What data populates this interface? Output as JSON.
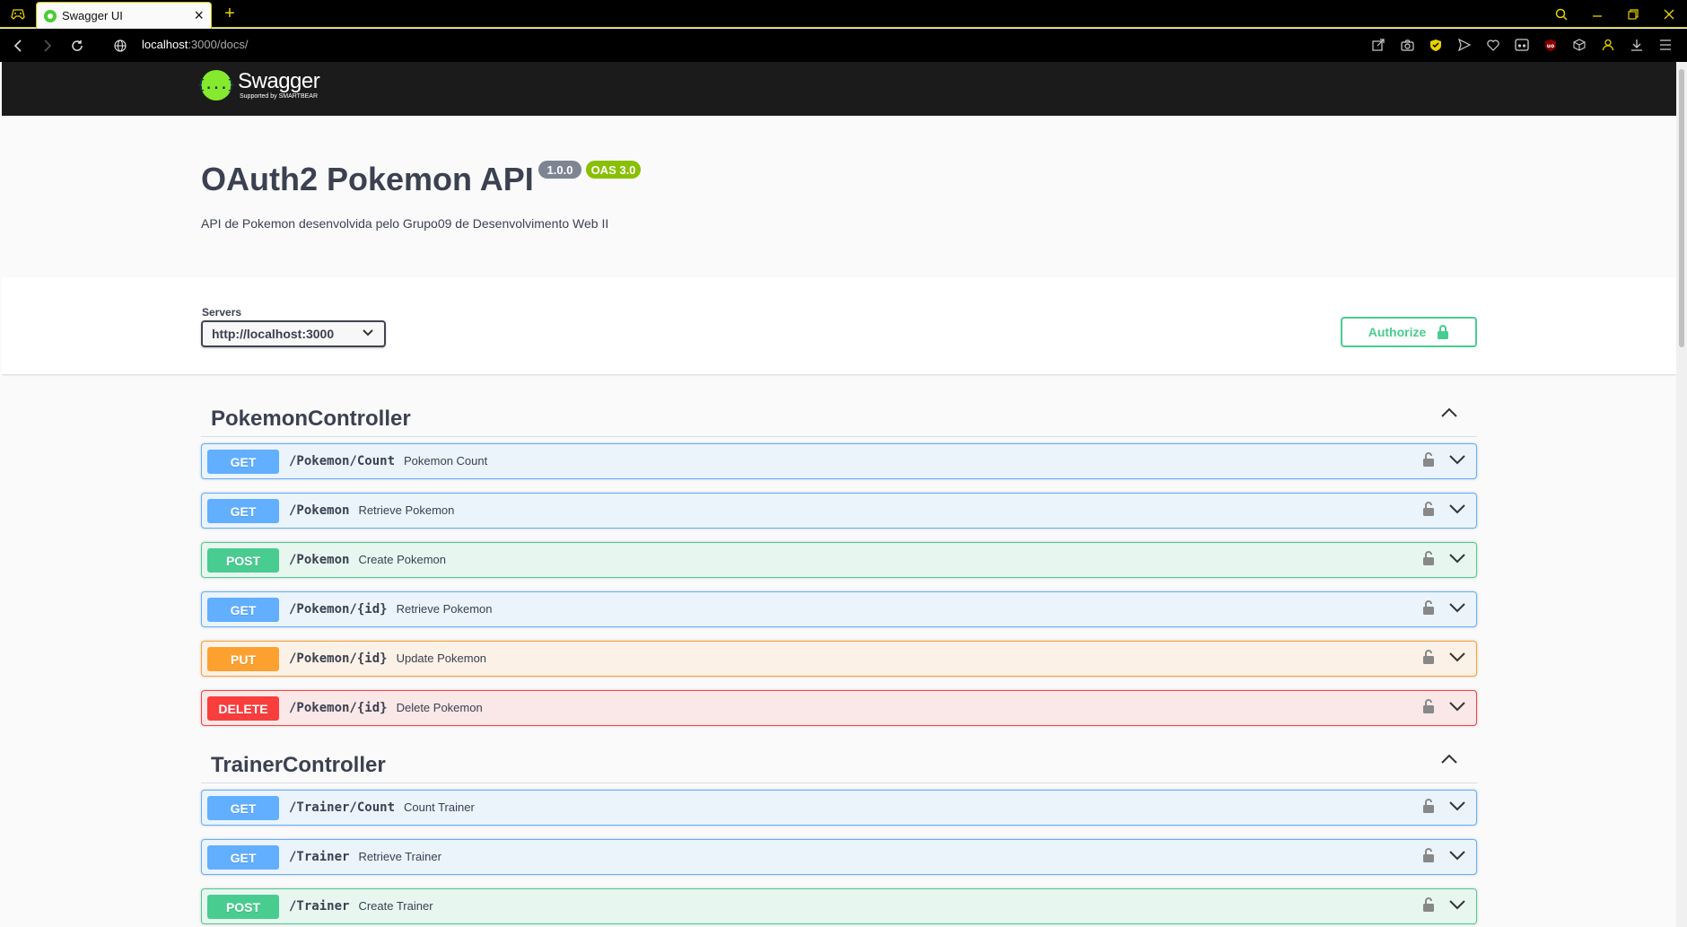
{
  "browser": {
    "tab_title": "Swagger UI",
    "url_host": "localhost",
    "url_rest": ":3000/docs/"
  },
  "swagger": {
    "logo_name": "Swagger",
    "logo_sub": "Supported by SMARTBEAR",
    "logo_glyph": "{...}"
  },
  "info": {
    "title": "OAuth2 Pokemon API",
    "version": "1.0.0",
    "oas": "OAS 3.0",
    "description": "API de Pokemon desenvolvida pelo Grupo09 de Desenvolvimento Web II"
  },
  "servers": {
    "label": "Servers",
    "selected": "http://localhost:3000"
  },
  "authorize_label": "Authorize",
  "method_colors": {
    "GET": "#61affe",
    "POST": "#49cc90",
    "PUT": "#fca130",
    "DELETE": "#f93e3e"
  },
  "sections": [
    {
      "name": "PokemonController",
      "operations": [
        {
          "method": "GET",
          "path": "/Pokemon/Count",
          "summary": "Pokemon Count"
        },
        {
          "method": "GET",
          "path": "/Pokemon",
          "summary": "Retrieve Pokemon"
        },
        {
          "method": "POST",
          "path": "/Pokemon",
          "summary": "Create Pokemon"
        },
        {
          "method": "GET",
          "path": "/Pokemon/{id}",
          "summary": "Retrieve Pokemon"
        },
        {
          "method": "PUT",
          "path": "/Pokemon/{id}",
          "summary": "Update Pokemon"
        },
        {
          "method": "DELETE",
          "path": "/Pokemon/{id}",
          "summary": "Delete Pokemon"
        }
      ]
    },
    {
      "name": "TrainerController",
      "operations": [
        {
          "method": "GET",
          "path": "/Trainer/Count",
          "summary": "Count Trainer"
        },
        {
          "method": "GET",
          "path": "/Trainer",
          "summary": "Retrieve Trainer"
        },
        {
          "method": "POST",
          "path": "/Trainer",
          "summary": "Create Trainer"
        }
      ]
    }
  ]
}
